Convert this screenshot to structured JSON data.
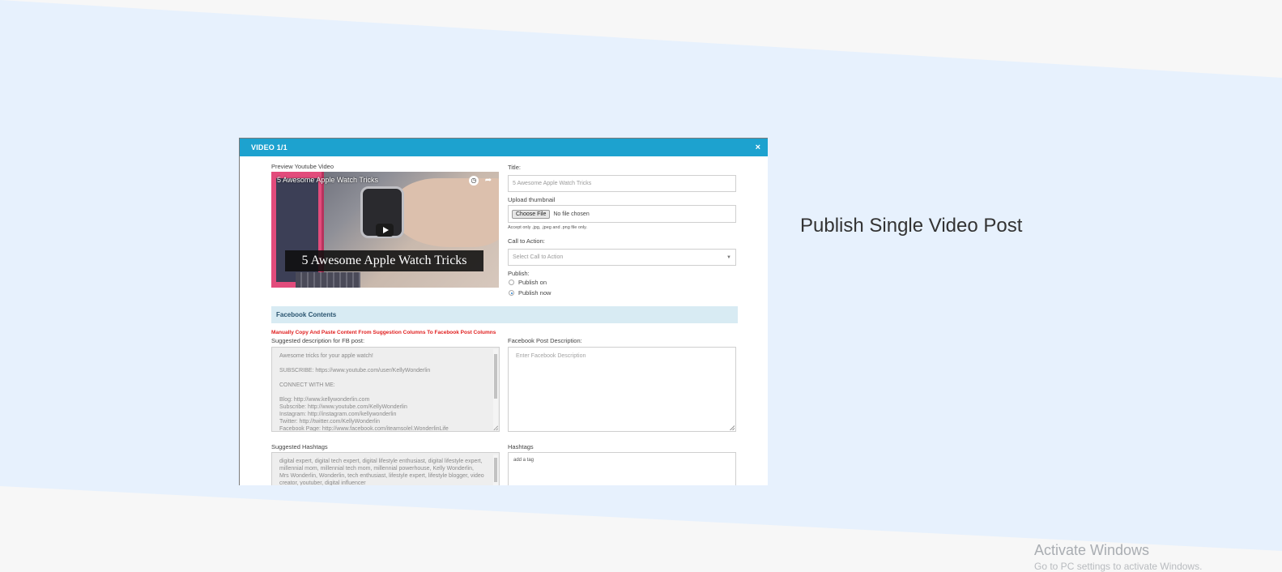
{
  "modal": {
    "header_title": "VIDEO 1/1",
    "close_glyph": "×",
    "preview_label": "Preview Youtube Video",
    "video": {
      "top_title": "5 Awesome Apple Watch Tricks",
      "caption": "5 Awesome Apple Watch Tricks",
      "clock_glyph": "◷",
      "share_glyph": "➦"
    },
    "title_label": "Title:",
    "title_value": "5 Awesome Apple Watch Tricks",
    "thumbnail_label": "Upload thumbnail",
    "choose_file_label": "Choose File",
    "no_file_text": "No file chosen",
    "thumbnail_hint": "Accept only .jpg, .jpeg and .png file only.",
    "cta_label": "Call to Action:",
    "cta_placeholder": "Select Call to Action",
    "publish_label": "Publish:",
    "publish_options": [
      {
        "label": "Publish on",
        "selected": false
      },
      {
        "label": "Publish now",
        "selected": true
      }
    ],
    "fb_section_title": "Facebook Contents",
    "fb_instructions": "Manually Copy And Paste Content From Suggestion Columns To Facebook Post Columns",
    "suggested_desc_label": "Suggested description for FB post:",
    "suggested_desc_lines": [
      "Awesome tricks for your apple watch!",
      "",
      "SUBSCRIBE: https://www.youtube.com/user/KellyWonderlin",
      "",
      "CONNECT WITH ME:",
      "",
      "Blog: http://www.kellywonderlin.com",
      "Subscribe: http://www.youtube.com/KellyWonderlin",
      "Instagram: http://instagram.com/kellywonderlin",
      "Twitter: http://twitter.com/KellyWonderlin",
      "Facebook Page: http://www.facebook.com/iteamsolel.WonderlinLife"
    ],
    "fb_desc_label": "Facebook Post Description:",
    "fb_desc_placeholder": "Enter Facebook Description",
    "suggested_hashtags_label": "Suggested Hashtags",
    "suggested_hashtags_text": "digital expert, digital tech expert, digital lifestyle enthusiast, digital lifestyle expert, millennial mom, millennial tech mom, millennial powerhouse, Kelly Wonderlin, Mrs Wonderlin, Wonderlin, tech enthusiast, lifestyle expert, lifestyle blogger, video creator, youtuber, digital influencer",
    "hashtags_label": "Hashtags",
    "hashtags_placeholder": "add a tag"
  },
  "right_heading": "Publish Single Video Post",
  "watermark": {
    "title": "Activate Windows",
    "subtitle": "Go to PC settings to activate Windows."
  },
  "colors": {
    "band": "#e7f1fd",
    "header": "#1da2cf",
    "fb_section": "#d8ebf3",
    "instructions": "#e01e1e"
  }
}
